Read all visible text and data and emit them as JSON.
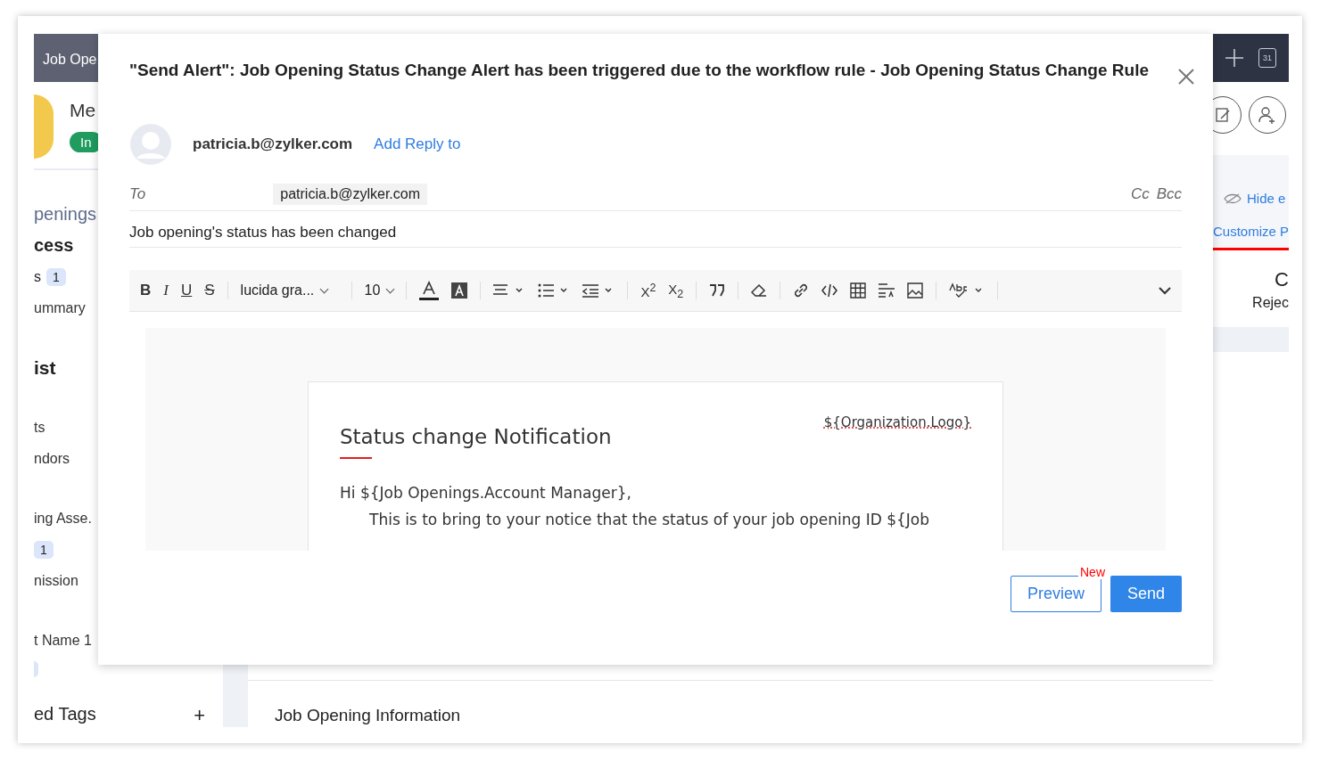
{
  "background": {
    "header_tab": "Job Ope",
    "calendar_day": "31",
    "record_name": "Me",
    "record_badge": "In",
    "sidebar": [
      {
        "items": [
          {
            "kind": "section",
            "label": "penings"
          },
          {
            "kind": "heading",
            "label": "cess"
          },
          {
            "kind": "count",
            "label": "s",
            "count": "1"
          },
          {
            "kind": "item",
            "label": "ummary"
          }
        ]
      },
      {
        "items": [
          {
            "kind": "title",
            "label": "ist"
          }
        ]
      },
      {
        "items": [
          {
            "kind": "item",
            "label": "ts"
          },
          {
            "kind": "item",
            "label": "ndors"
          }
        ]
      },
      {
        "items": [
          {
            "kind": "item",
            "label": "ing Asse."
          },
          {
            "kind": "count",
            "count": "1"
          },
          {
            "kind": "item",
            "label": "nission"
          }
        ]
      },
      {
        "items": [
          {
            "kind": "item",
            "label": "t Name 1"
          },
          {
            "kind": "pill"
          }
        ]
      }
    ],
    "tags_label": "ed Tags",
    "tags_add": "+",
    "hide_link": "Hide e",
    "customize_tab": "Customize P",
    "stat_value": "C",
    "stat_label": "Rejec",
    "section_title": "Job Opening Information"
  },
  "dialog": {
    "title": "\"Send Alert\": Job Opening Status Change Alert has been triggered due to the workflow rule - Job Opening Status Change Rule",
    "from": "patricia.b@zylker.com",
    "add_reply_to": "Add Reply to",
    "to_label": "To",
    "to_chip": "patricia.b@zylker.com",
    "cc": "Cc",
    "bcc": "Bcc",
    "subject": "Job opening's status has been changed",
    "toolbar": {
      "style_buttons": [
        "B",
        "I",
        "U",
        "S"
      ],
      "font": "lucida gra...",
      "size": "10",
      "script_buttons": [
        "X$^{2}$",
        "X$_{2}$"
      ]
    },
    "body": {
      "logo_placeholder": "${Organization.Logo}",
      "heading": "Status change Notification",
      "greeting": "Hi ${Job Openings.Account Manager},",
      "paragraph": "This is to bring to your notice that the status of your job opening ID ${Job"
    },
    "preview_badge": "New",
    "preview": "Preview",
    "send": "Send"
  }
}
